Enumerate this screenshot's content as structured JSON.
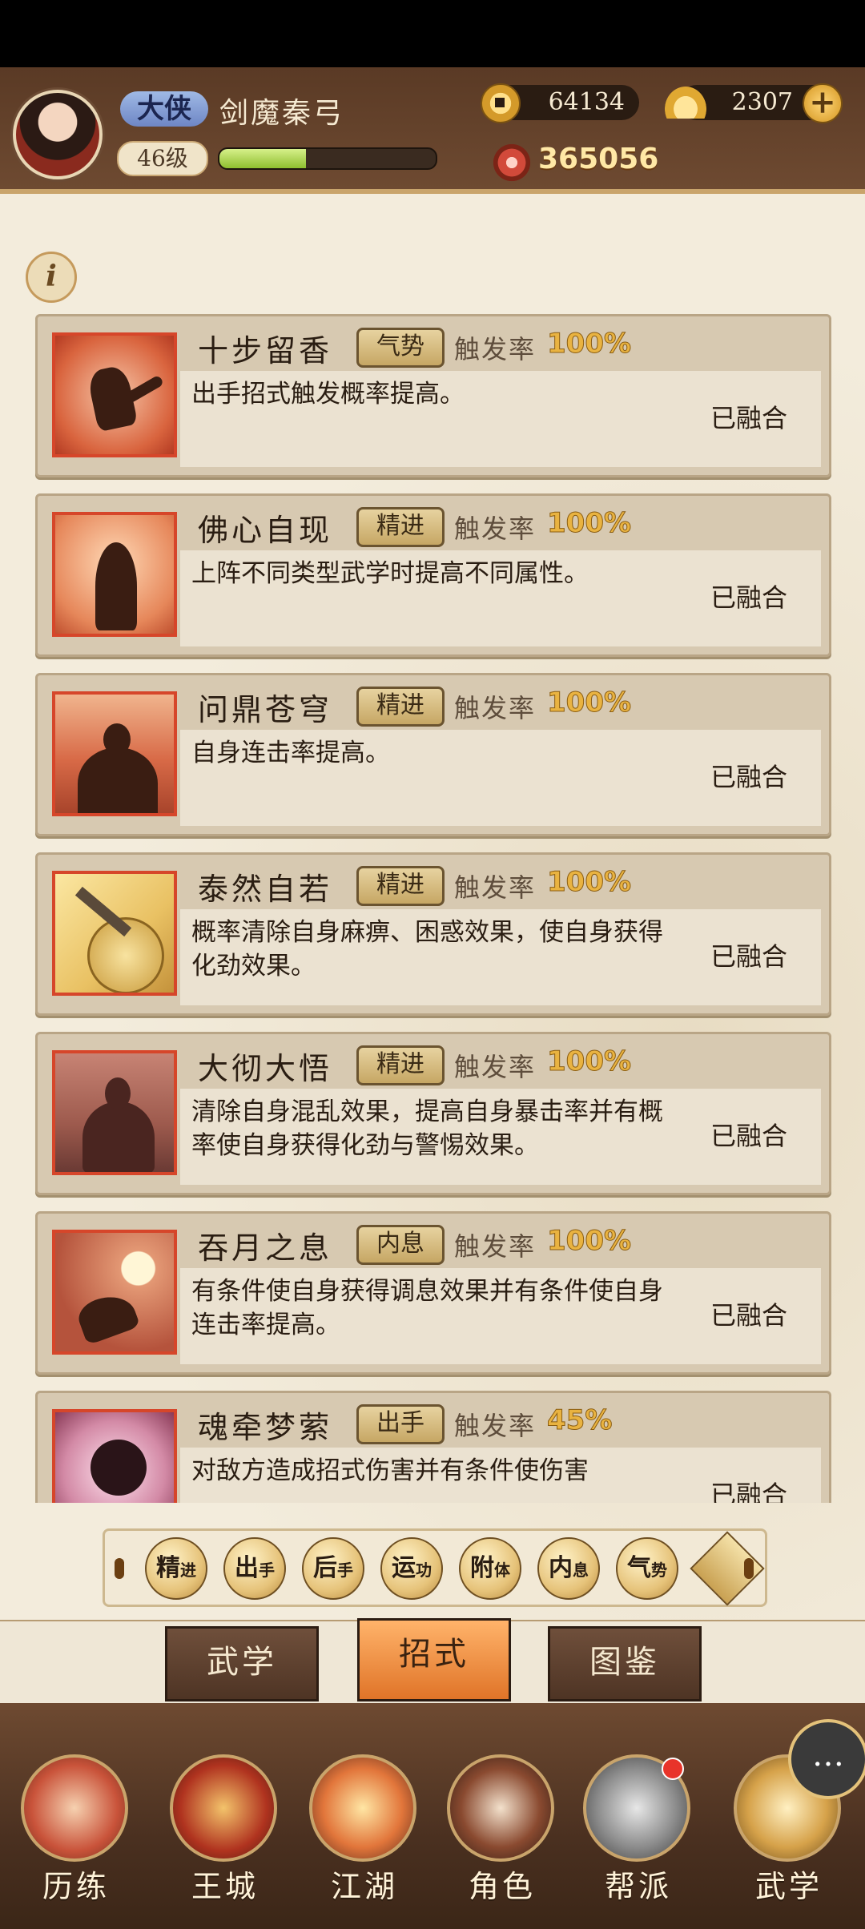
{
  "header": {
    "title_badge": "大侠",
    "player_name": "剑魔秦弓",
    "level": "46级",
    "xp_fraction": 0.4,
    "coins": "64134",
    "ingots": "2307",
    "power": "365056"
  },
  "list": {
    "rate_label": "触发率",
    "items": [
      {
        "name": "十步留香",
        "tag": "气势",
        "rate": "100%",
        "desc": "出手招式触发概率提高。",
        "status": "已融合"
      },
      {
        "name": "佛心自现",
        "tag": "精进",
        "rate": "100%",
        "desc": "上阵不同类型武学时提高不同属性。",
        "status": "已融合"
      },
      {
        "name": "问鼎苍穹",
        "tag": "精进",
        "rate": "100%",
        "desc": "自身连击率提高。",
        "status": "已融合"
      },
      {
        "name": "泰然自若",
        "tag": "精进",
        "rate": "100%",
        "desc": "概率清除自身麻痹、困惑效果，使自身获得化劲效果。",
        "status": "已融合"
      },
      {
        "name": "大彻大悟",
        "tag": "精进",
        "rate": "100%",
        "desc": "清除自身混乱效果，提高自身暴击率并有概率使自身获得化劲与警惕效果。",
        "status": "已融合"
      },
      {
        "name": "吞月之息",
        "tag": "内息",
        "rate": "100%",
        "desc": "有条件使自身获得调息效果并有条件使自身连击率提高。",
        "status": "已融合"
      },
      {
        "name": "魂牵梦萦",
        "tag": "出手",
        "rate": "45%",
        "desc": "对敌方造成招式伤害并有条件使伤害",
        "status": "已融合"
      }
    ]
  },
  "filters": {
    "chips": [
      {
        "a": "精",
        "b": "进"
      },
      {
        "a": "出",
        "b": "手"
      },
      {
        "a": "后",
        "b": "手"
      },
      {
        "a": "运",
        "b": "功"
      },
      {
        "a": "附",
        "b": "体"
      },
      {
        "a": "内",
        "b": "息"
      },
      {
        "a": "气",
        "b": "势"
      }
    ]
  },
  "tabs": [
    "武学",
    "招式",
    "图鉴"
  ],
  "bottom_nav": [
    "历练",
    "王城",
    "江湖",
    "角色",
    "帮派",
    "武学"
  ],
  "colors": {
    "accent": "#e07428",
    "rate_gold": "#e9b341",
    "tag_border": "#6b5430"
  }
}
